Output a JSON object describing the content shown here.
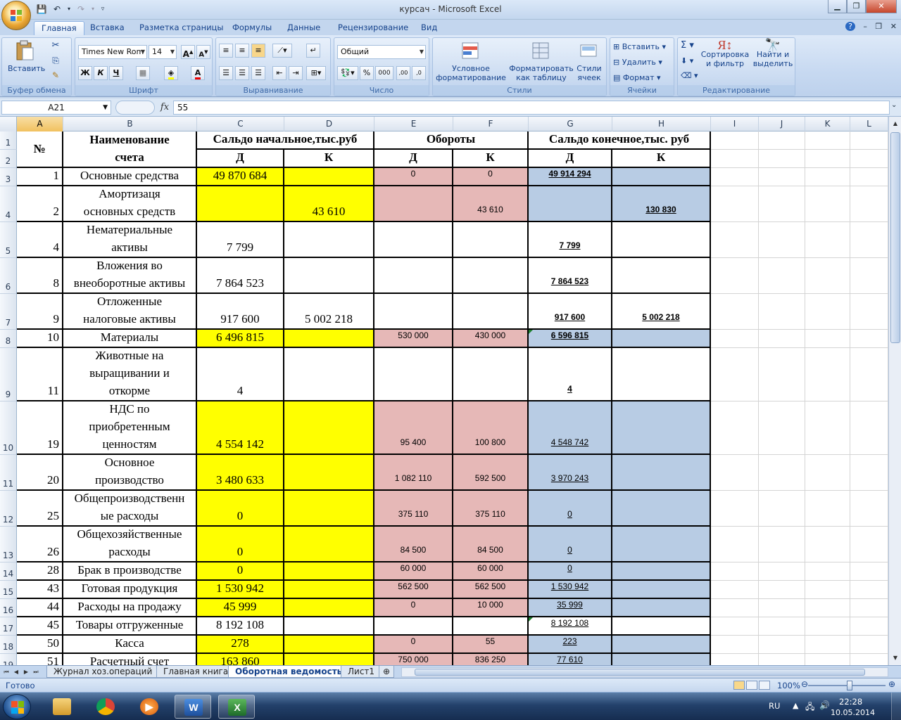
{
  "window": {
    "title": "курсач - Microsoft Excel"
  },
  "ribbon": {
    "tabs": [
      "Главная",
      "Вставка",
      "Разметка страницы",
      "Формулы",
      "Данные",
      "Рецензирование",
      "Вид"
    ],
    "active_tab": "Главная",
    "clipboard": {
      "paste": "Вставить",
      "label": "Буфер обмена"
    },
    "font": {
      "name": "Times New Rom",
      "size": "14",
      "bold": "Ж",
      "italic": "К",
      "underline": "Ч",
      "label": "Шрифт"
    },
    "alignment": {
      "label": "Выравнивание"
    },
    "number": {
      "format": "Общий",
      "label": "Число"
    },
    "styles": {
      "conditional_1": "Условное",
      "conditional_2": "форматирование",
      "table_1": "Форматировать",
      "table_2": "как таблицу",
      "cell_1": "Стили",
      "cell_2": "ячеек",
      "label": "Стили"
    },
    "cells": {
      "insert": "Вставить",
      "delete": "Удалить",
      "format": "Формат",
      "label": "Ячейки"
    },
    "editing": {
      "sort_1": "Сортировка",
      "sort_2": "и фильтр",
      "find_1": "Найти и",
      "find_2": "выделить",
      "label": "Редактирование"
    }
  },
  "formula_bar": {
    "name_box": "A21",
    "fx": "fx",
    "value": "55"
  },
  "columns": [
    "A",
    "B",
    "C",
    "D",
    "E",
    "F",
    "G",
    "H",
    "I",
    "J",
    "K",
    "L"
  ],
  "headers": {
    "num": "№",
    "account_1": "Наименование",
    "account_2": "счета",
    "opening": "Сальдо начальное,тыс.руб",
    "turnover": "Обороты",
    "closing": "Сальдо конечное,тыс. руб",
    "d": "Д",
    "k": "К"
  },
  "rows": [
    {
      "row": "3",
      "no": "1",
      "name": [
        "Основные средства"
      ],
      "c": "49 870 684",
      "d": "",
      "e": "0",
      "f": "0",
      "g": "49 914 294",
      "h": ""
    },
    {
      "row": "4",
      "no": "2",
      "name": [
        "Амортизаця",
        "основных средств"
      ],
      "c": "",
      "d": "43 610",
      "e": "",
      "f": "43 610",
      "g": "",
      "h": "130 830"
    },
    {
      "row": "5",
      "no": "4",
      "name": [
        "Нематериальные",
        "активы"
      ],
      "c": "7 799",
      "d": "",
      "e": "",
      "f": "",
      "g": "7 799",
      "h": ""
    },
    {
      "row": "6",
      "no": "8",
      "name": [
        "Вложения во",
        "внеоборотные активы"
      ],
      "c": "7 864 523",
      "d": "",
      "e": "",
      "f": "",
      "g": "7 864 523",
      "h": ""
    },
    {
      "row": "7",
      "no": "9",
      "name": [
        "Отложенные",
        "налоговые активы"
      ],
      "c": "917 600",
      "d": "5 002 218",
      "e": "",
      "f": "",
      "g": "917 600",
      "h": "5 002 218"
    },
    {
      "row": "8",
      "no": "10",
      "name": [
        "Материалы"
      ],
      "c": "6 496 815",
      "d": "",
      "e": "530 000",
      "f": "430 000",
      "g": "6 596 815",
      "h": ""
    },
    {
      "row": "9",
      "no": "11",
      "name": [
        "Животные на",
        "выращивании и",
        "откорме"
      ],
      "c": "4",
      "d": "",
      "e": "",
      "f": "",
      "g": "4",
      "h": ""
    },
    {
      "row": "10",
      "no": "19",
      "name": [
        "НДС по",
        "приобретенным",
        "ценностям"
      ],
      "c": "4 554 142",
      "d": "",
      "e": "95 400",
      "f": "100 800",
      "g": "4 548 742",
      "h": ""
    },
    {
      "row": "11",
      "no": "20",
      "name": [
        "Основное",
        "производство"
      ],
      "c": "3 480 633",
      "d": "",
      "e": "1 082 110",
      "f": "592 500",
      "g": "3 970 243",
      "h": ""
    },
    {
      "row": "12",
      "no": "25",
      "name": [
        "Общепроизводственн",
        "ые расходы"
      ],
      "c": "0",
      "d": "",
      "e": "375 110",
      "f": "375 110",
      "g": "0",
      "h": ""
    },
    {
      "row": "13",
      "no": "26",
      "name": [
        "Общехозяйственные",
        "расходы"
      ],
      "c": "0",
      "d": "",
      "e": "84 500",
      "f": "84 500",
      "g": "0",
      "h": ""
    },
    {
      "row": "14",
      "no": "28",
      "name": [
        "Брак в производстве"
      ],
      "c": "0",
      "d": "",
      "e": "60 000",
      "f": "60 000",
      "g": "0",
      "h": ""
    },
    {
      "row": "15",
      "no": "43",
      "name": [
        "Готовая продукция"
      ],
      "c": "1 530 942",
      "d": "",
      "e": "562 500",
      "f": "562 500",
      "g": "1 530 942",
      "h": ""
    },
    {
      "row": "16",
      "no": "44",
      "name": [
        "Расходы на продажу"
      ],
      "c": "45 999",
      "d": "",
      "e": "0",
      "f": "10 000",
      "g": "35 999",
      "h": ""
    },
    {
      "row": "17",
      "no": "45",
      "name": [
        "Товары отгруженные"
      ],
      "c": "8 192 108",
      "d": "",
      "e": "",
      "f": "",
      "g": "8 192 108",
      "h": ""
    },
    {
      "row": "18",
      "no": "50",
      "name": [
        "Касса"
      ],
      "c": "278",
      "d": "",
      "e": "0",
      "f": "55",
      "g": "223",
      "h": ""
    },
    {
      "row": "19",
      "no": "51",
      "name": [
        "Расчетный счет"
      ],
      "c": "163 860",
      "d": "",
      "e": "750 000",
      "f": "836 250",
      "g": "77 610",
      "h": ""
    }
  ],
  "sheets": [
    "Журнал хоз.операций",
    "Главная книга",
    "Оборотная ведомость",
    "Лист1"
  ],
  "active_sheet": "Оборотная ведомость",
  "status": {
    "text": "Готово",
    "zoom": "100%"
  },
  "taskbar": {
    "lang": "RU",
    "time": "22:28",
    "date": "10.05.2014"
  },
  "colors": {
    "yellow": "#ffff00",
    "pink": "#e6b8b7",
    "blue": "#b8cce4"
  }
}
